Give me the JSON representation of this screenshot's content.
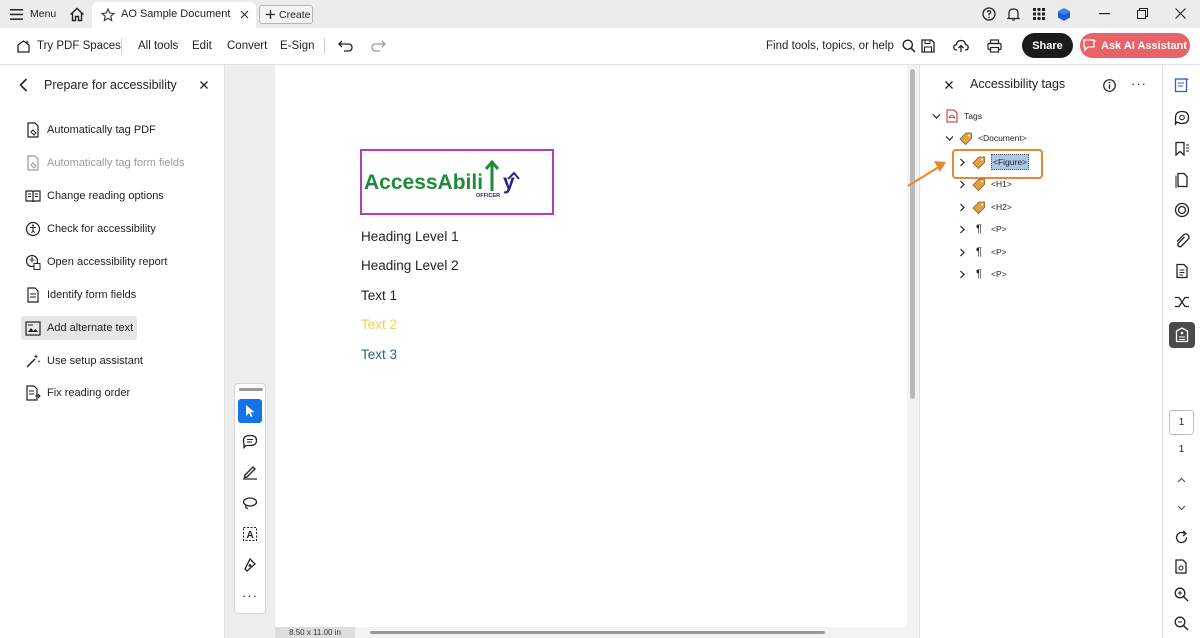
{
  "titlebar": {
    "menu_label": "Menu",
    "tab_title": "AO Sample Document",
    "create_label": "Create"
  },
  "toolbar": {
    "try_spaces": "Try PDF Spaces",
    "all_tools": "All tools",
    "edit": "Edit",
    "convert": "Convert",
    "esign": "E-Sign",
    "find_placeholder": "Find tools, topics, or help",
    "share": "Share",
    "ask_ai": "Ask AI Assistant"
  },
  "left_panel": {
    "title": "Prepare for accessibility",
    "items": [
      {
        "label": "Automatically tag PDF",
        "icon": "auto-tag-icon",
        "state": "normal"
      },
      {
        "label": "Automatically tag form fields",
        "icon": "auto-tag-form-icon",
        "state": "disabled"
      },
      {
        "label": "Change reading options",
        "icon": "reading-options-icon",
        "state": "normal"
      },
      {
        "label": "Check for accessibility",
        "icon": "check-accessibility-icon",
        "state": "normal"
      },
      {
        "label": "Open accessibility report",
        "icon": "report-icon",
        "state": "normal"
      },
      {
        "label": "Identify form fields",
        "icon": "form-fields-icon",
        "state": "normal"
      },
      {
        "label": "Add alternate text",
        "icon": "alt-text-icon",
        "state": "active"
      },
      {
        "label": "Use setup assistant",
        "icon": "wand-icon",
        "state": "normal"
      },
      {
        "label": "Fix reading order",
        "icon": "reading-order-icon",
        "state": "normal"
      }
    ]
  },
  "document": {
    "logo_text_a": "AccessAbili",
    "logo_text_b": "y",
    "logo_sub": "OFFICER",
    "lines": [
      {
        "text": "Heading Level 1",
        "color": "#222222"
      },
      {
        "text": "Heading Level 2",
        "color": "#222222"
      },
      {
        "text": "Text 1",
        "color": "#222222"
      },
      {
        "text": "Text 2",
        "color": "#f2d34c"
      },
      {
        "text": "Text 3",
        "color": "#2f5f7f"
      }
    ],
    "page_size": "8.50 x 11.00 in"
  },
  "tags_panel": {
    "title": "Accessibility tags",
    "tree": {
      "root": "Tags",
      "document": "<Document>",
      "children": [
        "<Figure>",
        "<H1>",
        "<H2>",
        "<P>",
        "<P>",
        "<P>"
      ]
    }
  },
  "rail": {
    "page_current": "1",
    "page_total": "1"
  },
  "colors": {
    "accent_blue": "#1473e6",
    "highlight_orange": "#e38b31",
    "logo_green": "#1e8c3a",
    "logo_blue": "#26258f",
    "logo_border": "#b23cbc"
  }
}
